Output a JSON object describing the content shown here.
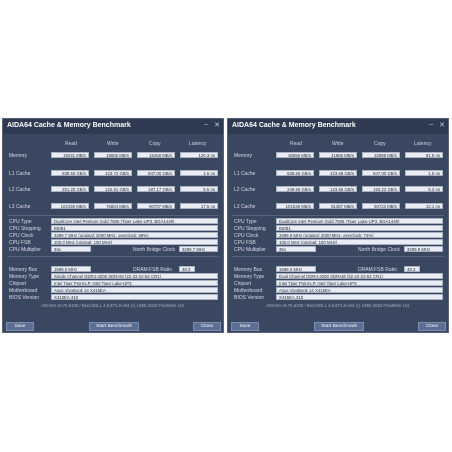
{
  "windows": [
    {
      "title": "AIDA64 Cache & Memory Benchmark",
      "headers": {
        "read": "Read",
        "write": "Write",
        "copy": "Copy",
        "latency": "Latency"
      },
      "rows": [
        {
          "label": "Memory",
          "read": "19431 MB/s",
          "write": "18605 MB/s",
          "copy": "15268 MB/s",
          "latency": "120.3 ns"
        },
        {
          "label": "L1 Cache",
          "read": "838.50 GB/s",
          "write": "423.72 GB/s",
          "copy": "847.00 GB/s",
          "latency": "1.6 ns"
        },
        {
          "label": "L2 Cache",
          "read": "251.20 GB/s",
          "write": "122.81 GB/s",
          "copy": "187.17 GB/s",
          "latency": "5.5 ns"
        },
        {
          "label": "L3 Cache",
          "read": "102195 MB/s",
          "write": "76804 MB/s",
          "copy": "90707 MB/s",
          "latency": "17.6 ns"
        }
      ],
      "cpu_type_label": "CPU Type",
      "cpu_type": "DualCore Intel Pentium Gold 7505 (Tiger Lake-UP3, BGA1449)",
      "cpu_stepping_label": "CPU Stepping",
      "cpu_stepping": "B0/B1",
      "cpu_clock_label": "CPU Clock",
      "cpu_clock": "3399.7 MHz (original: 2000 MHz, overclock: 69%)",
      "cpu_fsb_label": "CPU FSB",
      "cpu_fsb": "100.0 MHz (original: 100 MHz)",
      "cpu_mult_label": "CPU Multiplier",
      "cpu_mult": "34x",
      "nb_clock_label": "North Bridge Clock",
      "nb_clock": "3299.7 MHz",
      "mem_bus_label": "Memory Bus",
      "mem_bus": "1599.0 MHz",
      "dram_ratio_label": "DRAM:FSB Ratio",
      "dram_ratio": "48:3",
      "mem_type_label": "Memory Type",
      "mem_type": "Single Channel DDR4-3200 SDRAM (22-22-22-52 CR1)",
      "chipset_label": "Chipset",
      "chipset": "Intel Tiger Point-LP, Intel Tiger Lake-UP3",
      "motherboard_label": "Motherboard",
      "motherboard": "Asus VivoBook 14 X415EA",
      "bios_label": "BIOS Version",
      "bios": "X415EA.310",
      "footer": "AIDA64 v6.75.6100 / BenchDLL 4.6.871.8-x64 (c) 1995-2022 FinalWire Ltd.",
      "save": "Save",
      "start": "Start Benchmark",
      "close": "Close"
    },
    {
      "title": "AIDA64 Cache & Memory Benchmark",
      "headers": {
        "read": "Read",
        "write": "Write",
        "copy": "Copy",
        "latency": "Latency"
      },
      "rows": [
        {
          "label": "Memory",
          "read": "36556 MB/s",
          "write": "41866 MB/s",
          "copy": "32889 MB/s",
          "latency": "91.5 ns"
        },
        {
          "label": "L1 Cache",
          "read": "838.66 GB/s",
          "write": "423.69 GB/s",
          "copy": "847.00 GB/s",
          "latency": "1.5 ns"
        },
        {
          "label": "L2 Cache",
          "read": "249.56 GB/s",
          "write": "123.56 GB/s",
          "copy": "193.22 GB/s",
          "latency": "5.3 ns"
        },
        {
          "label": "L3 Cache",
          "read": "101638 MB/s",
          "write": "81387 MB/s",
          "copy": "90723 MB/s",
          "latency": "12.1 ns"
        }
      ],
      "cpu_type_label": "CPU Type",
      "cpu_type": "DualCore Intel Pentium Gold 7505 (Tiger Lake-UP3, BGA1449)",
      "cpu_stepping_label": "CPU Stepping",
      "cpu_stepping": "B0/B1",
      "cpu_clock_label": "CPU Clock",
      "cpu_clock": "3499.9 MHz (original: 2000 MHz, overclock: 74%)",
      "cpu_fsb_label": "CPU FSB",
      "cpu_fsb": "100.0 MHz (original: 100 MHz)",
      "cpu_mult_label": "CPU Multiplier",
      "cpu_mult": "35x",
      "nb_clock_label": "North Bridge Clock",
      "nb_clock": "3299.9 MHz",
      "mem_bus_label": "Memory Bus",
      "mem_bus": "1599.0 MHz",
      "dram_ratio_label": "DRAM:FSB Ratio",
      "dram_ratio": "48:3",
      "mem_type_label": "Memory Type",
      "mem_type": "Dual Channel DDR4-3200 SDRAM (22-22-22-52 CR1)",
      "chipset_label": "Chipset",
      "chipset": "Intel Tiger Point-LP, Intel Tiger Lake-UP3",
      "motherboard_label": "Motherboard",
      "motherboard": "Asus VivoBook 14 X415EA",
      "bios_label": "BIOS Version",
      "bios": "X415EA.310",
      "footer": "AIDA64 v6.75.6100 / BenchDLL 4.6.871.8-x64 (c) 1995-2022 FinalWire Ltd.",
      "save": "Save",
      "start": "Start Benchmark",
      "close": "Close"
    }
  ]
}
